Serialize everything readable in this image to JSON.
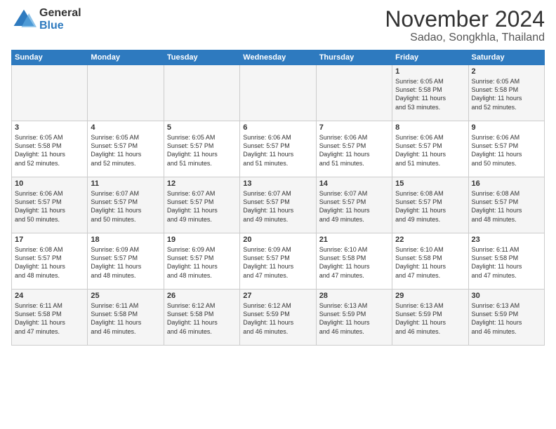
{
  "header": {
    "logo_general": "General",
    "logo_blue": "Blue",
    "month_title": "November 2024",
    "location": "Sadao, Songkhla, Thailand"
  },
  "calendar": {
    "weekdays": [
      "Sunday",
      "Monday",
      "Tuesday",
      "Wednesday",
      "Thursday",
      "Friday",
      "Saturday"
    ],
    "weeks": [
      [
        {
          "day": "",
          "info": ""
        },
        {
          "day": "",
          "info": ""
        },
        {
          "day": "",
          "info": ""
        },
        {
          "day": "",
          "info": ""
        },
        {
          "day": "",
          "info": ""
        },
        {
          "day": "1",
          "info": "Sunrise: 6:05 AM\nSunset: 5:58 PM\nDaylight: 11 hours\nand 53 minutes."
        },
        {
          "day": "2",
          "info": "Sunrise: 6:05 AM\nSunset: 5:58 PM\nDaylight: 11 hours\nand 52 minutes."
        }
      ],
      [
        {
          "day": "3",
          "info": "Sunrise: 6:05 AM\nSunset: 5:58 PM\nDaylight: 11 hours\nand 52 minutes."
        },
        {
          "day": "4",
          "info": "Sunrise: 6:05 AM\nSunset: 5:57 PM\nDaylight: 11 hours\nand 52 minutes."
        },
        {
          "day": "5",
          "info": "Sunrise: 6:05 AM\nSunset: 5:57 PM\nDaylight: 11 hours\nand 51 minutes."
        },
        {
          "day": "6",
          "info": "Sunrise: 6:06 AM\nSunset: 5:57 PM\nDaylight: 11 hours\nand 51 minutes."
        },
        {
          "day": "7",
          "info": "Sunrise: 6:06 AM\nSunset: 5:57 PM\nDaylight: 11 hours\nand 51 minutes."
        },
        {
          "day": "8",
          "info": "Sunrise: 6:06 AM\nSunset: 5:57 PM\nDaylight: 11 hours\nand 51 minutes."
        },
        {
          "day": "9",
          "info": "Sunrise: 6:06 AM\nSunset: 5:57 PM\nDaylight: 11 hours\nand 50 minutes."
        }
      ],
      [
        {
          "day": "10",
          "info": "Sunrise: 6:06 AM\nSunset: 5:57 PM\nDaylight: 11 hours\nand 50 minutes."
        },
        {
          "day": "11",
          "info": "Sunrise: 6:07 AM\nSunset: 5:57 PM\nDaylight: 11 hours\nand 50 minutes."
        },
        {
          "day": "12",
          "info": "Sunrise: 6:07 AM\nSunset: 5:57 PM\nDaylight: 11 hours\nand 49 minutes."
        },
        {
          "day": "13",
          "info": "Sunrise: 6:07 AM\nSunset: 5:57 PM\nDaylight: 11 hours\nand 49 minutes."
        },
        {
          "day": "14",
          "info": "Sunrise: 6:07 AM\nSunset: 5:57 PM\nDaylight: 11 hours\nand 49 minutes."
        },
        {
          "day": "15",
          "info": "Sunrise: 6:08 AM\nSunset: 5:57 PM\nDaylight: 11 hours\nand 49 minutes."
        },
        {
          "day": "16",
          "info": "Sunrise: 6:08 AM\nSunset: 5:57 PM\nDaylight: 11 hours\nand 48 minutes."
        }
      ],
      [
        {
          "day": "17",
          "info": "Sunrise: 6:08 AM\nSunset: 5:57 PM\nDaylight: 11 hours\nand 48 minutes."
        },
        {
          "day": "18",
          "info": "Sunrise: 6:09 AM\nSunset: 5:57 PM\nDaylight: 11 hours\nand 48 minutes."
        },
        {
          "day": "19",
          "info": "Sunrise: 6:09 AM\nSunset: 5:57 PM\nDaylight: 11 hours\nand 48 minutes."
        },
        {
          "day": "20",
          "info": "Sunrise: 6:09 AM\nSunset: 5:57 PM\nDaylight: 11 hours\nand 47 minutes."
        },
        {
          "day": "21",
          "info": "Sunrise: 6:10 AM\nSunset: 5:58 PM\nDaylight: 11 hours\nand 47 minutes."
        },
        {
          "day": "22",
          "info": "Sunrise: 6:10 AM\nSunset: 5:58 PM\nDaylight: 11 hours\nand 47 minutes."
        },
        {
          "day": "23",
          "info": "Sunrise: 6:11 AM\nSunset: 5:58 PM\nDaylight: 11 hours\nand 47 minutes."
        }
      ],
      [
        {
          "day": "24",
          "info": "Sunrise: 6:11 AM\nSunset: 5:58 PM\nDaylight: 11 hours\nand 47 minutes."
        },
        {
          "day": "25",
          "info": "Sunrise: 6:11 AM\nSunset: 5:58 PM\nDaylight: 11 hours\nand 46 minutes."
        },
        {
          "day": "26",
          "info": "Sunrise: 6:12 AM\nSunset: 5:58 PM\nDaylight: 11 hours\nand 46 minutes."
        },
        {
          "day": "27",
          "info": "Sunrise: 6:12 AM\nSunset: 5:59 PM\nDaylight: 11 hours\nand 46 minutes."
        },
        {
          "day": "28",
          "info": "Sunrise: 6:13 AM\nSunset: 5:59 PM\nDaylight: 11 hours\nand 46 minutes."
        },
        {
          "day": "29",
          "info": "Sunrise: 6:13 AM\nSunset: 5:59 PM\nDaylight: 11 hours\nand 46 minutes."
        },
        {
          "day": "30",
          "info": "Sunrise: 6:13 AM\nSunset: 5:59 PM\nDaylight: 11 hours\nand 46 minutes."
        }
      ]
    ]
  }
}
